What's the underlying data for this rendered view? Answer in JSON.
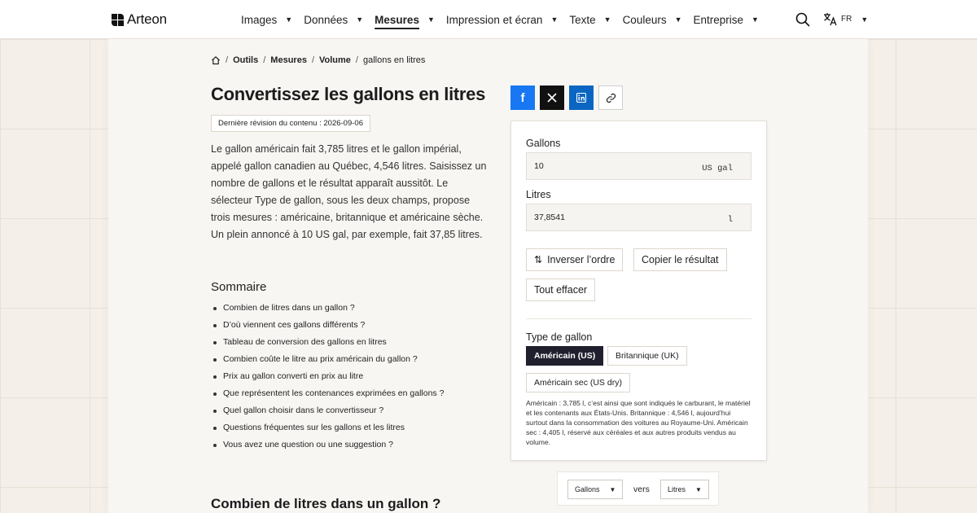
{
  "header": {
    "logo_text": "Arteon",
    "nav": [
      {
        "label": "Images",
        "active": false
      },
      {
        "label": "Données",
        "active": false
      },
      {
        "label": "Mesures",
        "active": true
      },
      {
        "label": "Impression et écran",
        "active": false
      },
      {
        "label": "Texte",
        "active": false
      },
      {
        "label": "Couleurs",
        "active": false
      },
      {
        "label": "Entreprise",
        "active": false
      }
    ],
    "lang": "FR"
  },
  "breadcrumb": {
    "items": [
      "Outils",
      "Mesures",
      "Volume"
    ],
    "current": "gallons en litres"
  },
  "page": {
    "title": "Convertissez les gallons en litres",
    "revision": "Dernière révision du contenu : 2026-09-06",
    "intro": "Le gallon américain fait 3,785 litres et le gallon impérial, appelé gallon canadien au Québec, 4,546 litres. Saisissez un nombre de gallons et le résultat apparaît aussitôt. Le sélecteur Type de gallon, sous les deux champs, propose trois mesures : américaine, britannique et américaine sèche. Un plein annoncé à 10 US gal, par exemple, fait 37,85 litres.",
    "summary_title": "Sommaire",
    "summary": [
      "Combien de litres dans un gallon ?",
      "D’où viennent ces gallons différents ?",
      "Tableau de conversion des gallons en litres",
      "Combien coûte le litre au prix américain du gallon ?",
      "Prix au gallon converti en prix au litre",
      "Que représentent les contenances exprimées en gallons ?",
      "Quel gallon choisir dans le convertisseur ?",
      "Questions fréquentes sur les gallons et les litres",
      "Vous avez une question ou une suggestion ?"
    ],
    "section_title": "Combien de litres dans un gallon ?"
  },
  "converter": {
    "from_label": "Gallons",
    "from_value": "10",
    "from_unit": "US gal",
    "to_label": "Litres",
    "to_value": "37,8541",
    "to_unit": "l",
    "swap_label": "Inverser l’ordre",
    "copy_label": "Copier le résultat",
    "clear_label": "Tout effacer",
    "type_label": "Type de gallon",
    "types": [
      {
        "label": "Américain (US)",
        "selected": true
      },
      {
        "label": "Britannique (UK)",
        "selected": false
      },
      {
        "label": "Américain sec (US dry)",
        "selected": false
      }
    ],
    "type_note": "Américain : 3,785 l, c’est ainsi que sont indiqués le carburant, le matériel et les contenants aux États-Unis. Britannique : 4,546 l, aujourd’hui surtout dans la consommation des voitures au Royaume-Uni. Américain sec : 4,405 l, réservé aux céréales et aux autres produits vendus au volume."
  },
  "mini_converter": {
    "from": "Gallons",
    "connector": "vers",
    "to": "Litres"
  },
  "colors": {
    "facebook": "#1877f2",
    "x": "#111111",
    "linkedin": "#0a66c2",
    "selected_type": "#1f1f2e"
  }
}
